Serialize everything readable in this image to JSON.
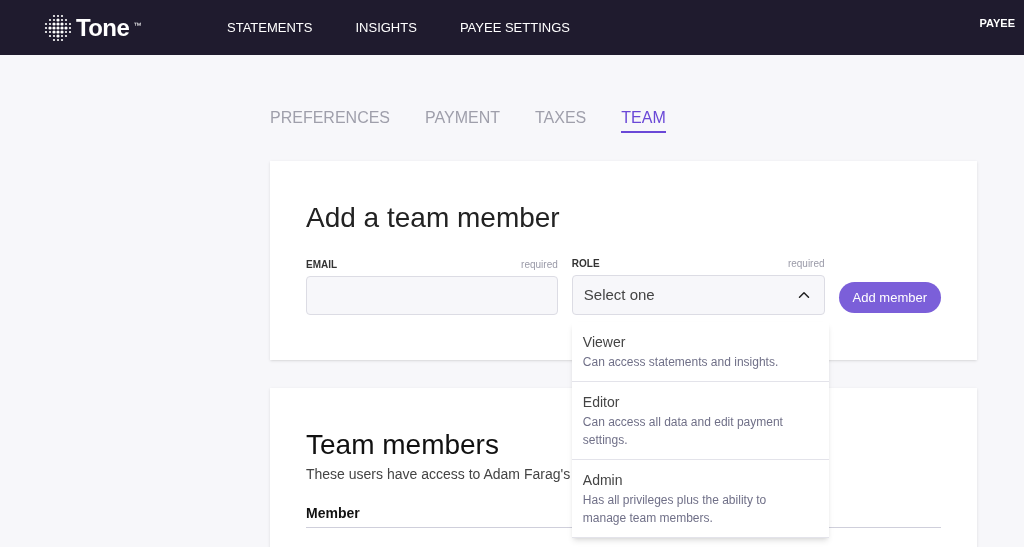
{
  "header": {
    "logo": "Tone",
    "trademark": "™",
    "nav": [
      {
        "label": "STATEMENTS"
      },
      {
        "label": "INSIGHTS"
      },
      {
        "label": "PAYEE SETTINGS"
      }
    ],
    "user": "PAYEE"
  },
  "tabs": [
    {
      "label": "PREFERENCES",
      "selected": false
    },
    {
      "label": "PAYMENT",
      "selected": false
    },
    {
      "label": "TAXES",
      "selected": false
    },
    {
      "label": "TEAM",
      "selected": true
    }
  ],
  "add_member": {
    "title": "Add a team member",
    "email": {
      "label": "EMAIL",
      "hint": "required"
    },
    "role": {
      "label": "ROLE",
      "hint": "required",
      "placeholder": "Select one",
      "expanded": true,
      "options": [
        {
          "name": "Viewer",
          "description": "Can access statements and insights."
        },
        {
          "name": "Editor",
          "description": "Can access all data and edit payment settings."
        },
        {
          "name": "Admin",
          "description": "Has all privileges plus the ability to manage team members."
        }
      ]
    },
    "button": "Add member"
  },
  "team_members": {
    "title": "Team members",
    "subtitle": "These users have access to Adam Farag's",
    "columns": [
      "Member"
    ]
  }
}
